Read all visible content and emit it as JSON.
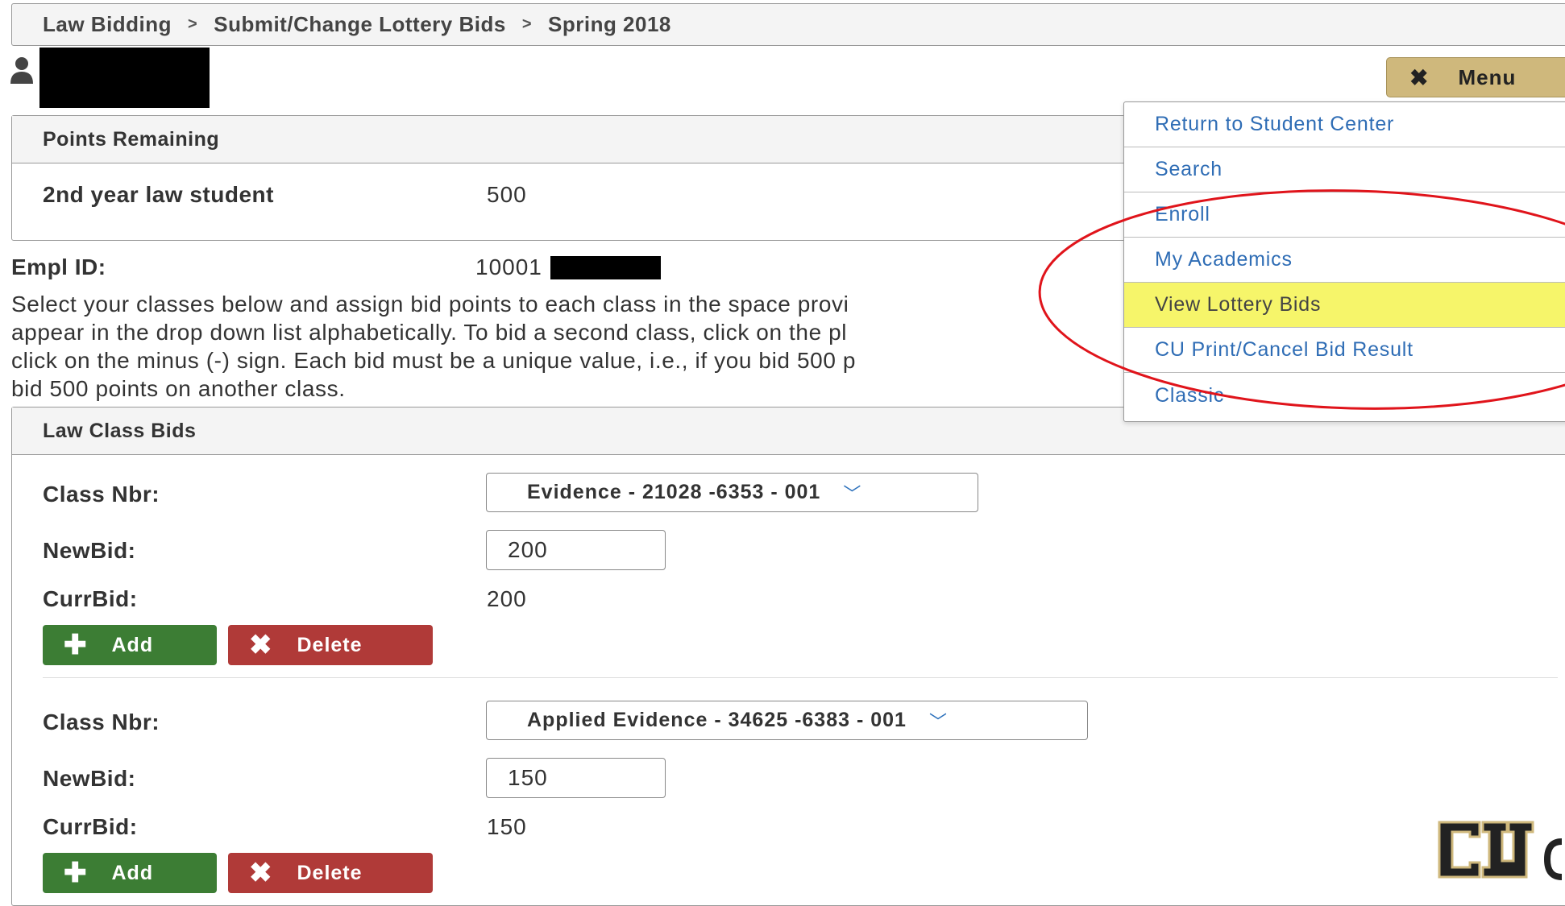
{
  "breadcrumb": {
    "items": [
      "Law Bidding",
      "Submit/Change Lottery Bids",
      "Spring 2018"
    ],
    "separator": ">"
  },
  "menu_button": {
    "label": "Menu",
    "icon": "close-icon"
  },
  "points": {
    "header": "Points Remaining",
    "student_type": "2nd year law student",
    "points": "500"
  },
  "empl": {
    "label": "Empl ID:",
    "value": "10001"
  },
  "instructions": "Select your classes below and assign bid points to each class in the space provi appear in the drop down list alphabetically. To bid a second class, click on the pl click on the minus (-) sign. Each bid must be a unique value, i.e., if you bid 500 p bid 500 points on another class.",
  "instructions_lines": [
    "Select your classes below and assign bid points to each class in the space provi",
    "appear in the drop down list alphabetically. To bid a second class, click on the pl",
    "click on the minus (-) sign. Each bid must be a unique value, i.e., if you bid 500 p",
    "bid 500 points on another class."
  ],
  "bids": {
    "header": "Law Class Bids",
    "labels": {
      "class_nbr": "Class Nbr:",
      "new_bid": "NewBid:",
      "curr_bid": "CurrBid:"
    },
    "add_label": "Add",
    "delete_label": "Delete",
    "entries": [
      {
        "class": "Evidence - 21028 -6353 - 001",
        "new_bid": "200",
        "curr_bid": "200"
      },
      {
        "class": "Applied Evidence - 34625 -6383 - 001",
        "new_bid": "150",
        "curr_bid": "150"
      }
    ]
  },
  "menu": {
    "items": [
      "Return to Student Center",
      "Search",
      "Enroll",
      "My Academics",
      "View Lottery Bids",
      "CU Print/Cancel Bid Result",
      "Classic"
    ],
    "highlighted_index": 4
  },
  "colors": {
    "accent_gold": "#cfb87c",
    "link_blue": "#2f6db5",
    "add_green": "#3c7d34",
    "delete_red": "#b03a38",
    "highlight_yellow": "#f6f56a",
    "annotation_red": "#e0141b"
  }
}
